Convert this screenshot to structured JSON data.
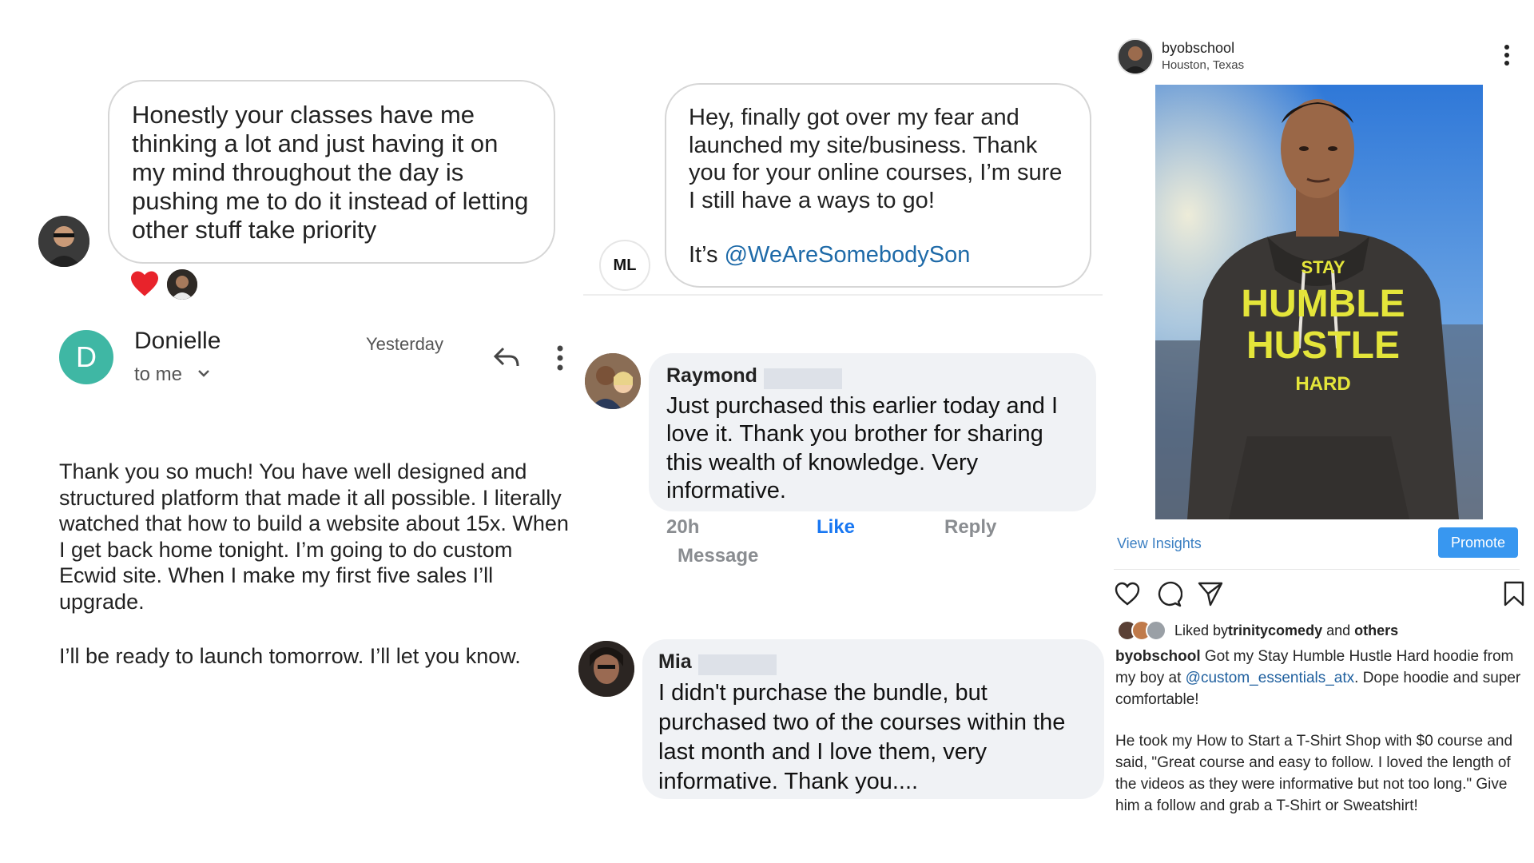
{
  "panel1": {
    "message": "Honestly your classes have me thinking a lot and just having it on my mind throughout the day is pushing me to do it instead of letting other stuff take priority",
    "reaction_icon": "heart-icon",
    "email": {
      "avatar_letter": "D",
      "sender": "Donielle",
      "time": "Yesterday",
      "recipient": "to me",
      "body_p1": "Thank you so much! You have well designed and structured platform that made it all possible. I literally watched that how to build a website about 15x. When I get back home tonight. I’m going to do custom Ecwid site. When I make my first five sales I’ll upgrade.",
      "body_p2": "I’ll be ready to launch tomorrow. I’ll let you know.",
      "avatar_color": "#3fb7a4"
    }
  },
  "panel2": {
    "message_main": "Hey, finally got over my fear and launched my site/business. Thank you for your online courses, I’m sure I still have a ways to go!",
    "message_prefix": "It’s ",
    "message_handle": "@WeAreSomebodySon",
    "logo_text": "ML",
    "comment1": {
      "name": "Raymond",
      "text": "Just purchased this earlier today and I love it. Thank you brother for sharing this wealth of knowledge. Very informative.",
      "time": "20h",
      "like_label": "Like",
      "reply_label": "Reply",
      "message_label": "Message"
    },
    "comment2": {
      "name": "Mia",
      "text": "I didn't purchase the bundle, but purchased two of the courses within the last month and I love them, very informative. Thank you...."
    }
  },
  "panel3": {
    "username": "byobschool",
    "location": "Houston, Texas",
    "hoodie_text": [
      "STAY",
      "HUMBLE",
      "HUSTLE",
      "HARD"
    ],
    "view_insights": "View Insights",
    "promote": "Promote",
    "liked_prefix": "Liked by ",
    "liked_user": "trinitycomedy",
    "liked_and": " and ",
    "liked_others": "others",
    "caption_user": "byobschool",
    "caption_a": " Got my Stay Humble Hustle Hard hoodie from my boy at ",
    "caption_handle": "@custom_essentials_atx",
    "caption_b": ". Dope hoodie and super comfortable!",
    "caption_p2": "He took my How to Start a T-Shirt Shop with $0 course and said, \"Great course and easy to follow. I loved the length of the videos as they were informative but not too long.\" Give him a follow and grab a T-Shirt or Sweatshirt!",
    "promote_color": "#3897f0",
    "icons": [
      "heart-icon",
      "comment-icon",
      "share-icon",
      "bookmark-icon"
    ]
  }
}
